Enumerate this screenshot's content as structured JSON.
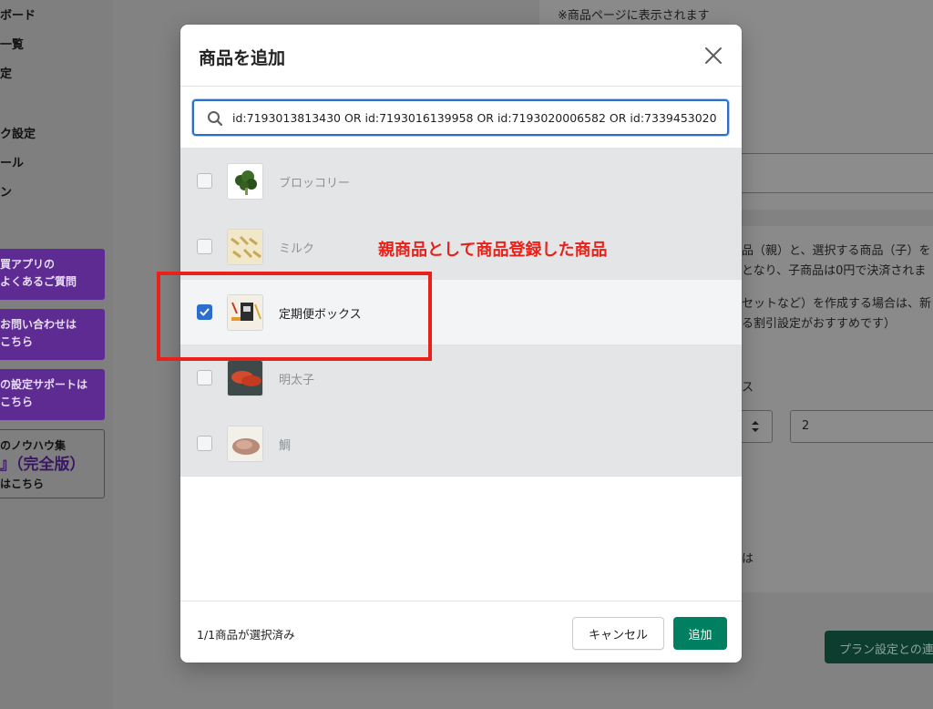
{
  "sidebar": {
    "items": [
      "ボード",
      "一覧",
      "定",
      "ク設定",
      "ール",
      "ン"
    ],
    "promo_1": [
      "買アプリの",
      "よくあるご質問"
    ],
    "promo_2": [
      "お問い合わせは",
      "こちら"
    ],
    "promo_3": [
      "の設定サポートは",
      "こちら"
    ],
    "promo_4": [
      "のノウハウ集",
      "』（完全版）",
      "はこちら"
    ]
  },
  "background": {
    "top_note": "※商品ページに表示されます",
    "desc_line_1": "品（親）と、選択する商品（子）を",
    "desc_line_2": "となり、子商品は0円で決済されま",
    "desc_line_3": "セットなど）を作成する場合は、新",
    "desc_line_4": "る割引設定がおすすめです）",
    "label_su": "ス",
    "label_ha": "は",
    "field_value": "2",
    "plan_button": "プラン設定との連"
  },
  "modal": {
    "title": "商品を追加",
    "search": {
      "value": "id:7193013813430 OR id:7193016139958 OR id:7193020006582 OR id:7339453020"
    },
    "products": [
      {
        "name": "ブロッコリー",
        "checked": false
      },
      {
        "name": "ミルク",
        "checked": false
      },
      {
        "name": "定期便ボックス",
        "checked": true
      },
      {
        "name": "明太子",
        "checked": false
      },
      {
        "name": "鯛",
        "checked": false
      }
    ],
    "selected_count": "1/1商品が選択済み",
    "cancel_label": "キャンセル",
    "add_label": "追加"
  },
  "annotation": {
    "text": "親商品として商品登録した商品",
    "color": "#e8221a"
  },
  "colors": {
    "primary": "#008060",
    "focus": "#2c6ecb",
    "sidebar_promo": "#5e2b92"
  }
}
